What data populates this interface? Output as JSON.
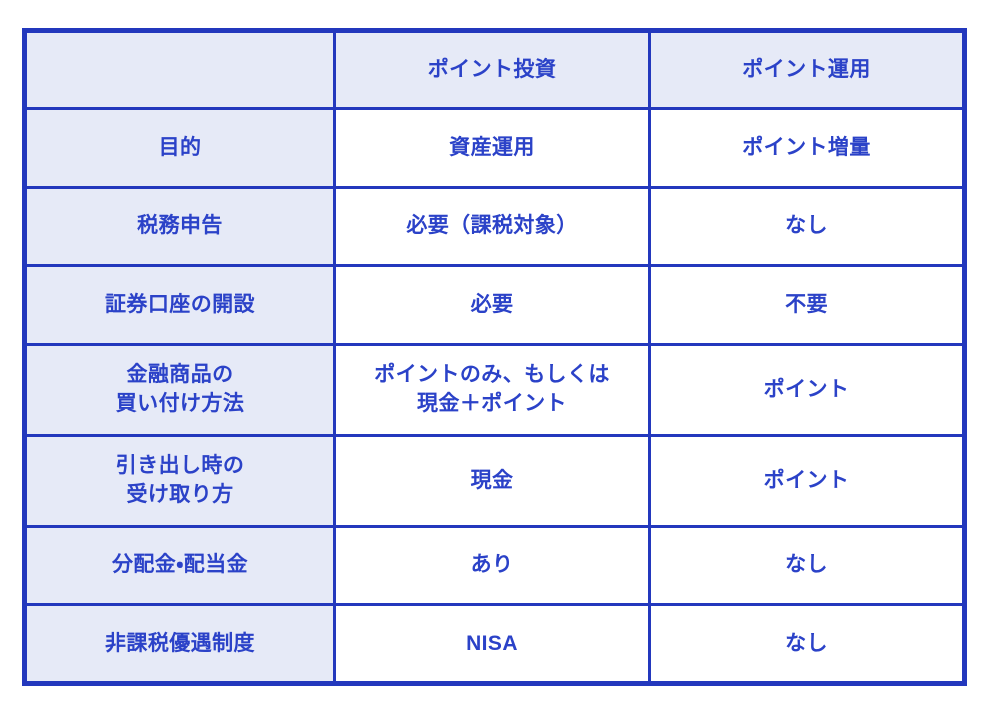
{
  "table": {
    "columns": [
      {
        "key": "label",
        "label": ""
      },
      {
        "key": "point_toushi",
        "label": "ポイント投資"
      },
      {
        "key": "point_unyou",
        "label": "ポイント運用"
      }
    ],
    "rows": [
      {
        "label": "目的",
        "label_lines": [
          "目的"
        ],
        "point_toushi": "資産運用",
        "toushi_lines": [
          "資産運用"
        ],
        "point_unyou": "ポイント増量",
        "unyou_lines": [
          "ポイント増量"
        ]
      },
      {
        "label": "税務申告",
        "label_lines": [
          "税務申告"
        ],
        "point_toushi": "必要（課税対象）",
        "toushi_lines": [
          "必要（課税対象）"
        ],
        "point_unyou": "なし",
        "unyou_lines": [
          "なし"
        ]
      },
      {
        "label": "証券口座の開設",
        "label_lines": [
          "証券口座の開設"
        ],
        "point_toushi": "必要",
        "toushi_lines": [
          "必要"
        ],
        "point_unyou": "不要",
        "unyou_lines": [
          "不要"
        ]
      },
      {
        "label": "金融商品の買い付け方法",
        "label_lines": [
          "金融商品の",
          "買い付け方法"
        ],
        "point_toushi": "ポイントのみ、もしくは現金＋ポイント",
        "toushi_lines": [
          "ポイントのみ、もしくは",
          "現金＋ポイント"
        ],
        "point_unyou": "ポイント",
        "unyou_lines": [
          "ポイント"
        ]
      },
      {
        "label": "引き出し時の受け取り方",
        "label_lines": [
          "引き出し時の",
          "受け取り方"
        ],
        "point_toushi": "現金",
        "toushi_lines": [
          "現金"
        ],
        "point_unyou": "ポイント",
        "unyou_lines": [
          "ポイント"
        ]
      },
      {
        "label": "分配金・配当金",
        "label_lines": [
          "分配金・配当金"
        ],
        "point_toushi": "あり",
        "toushi_lines": [
          "あり"
        ],
        "point_unyou": "なし",
        "unyou_lines": [
          "なし"
        ]
      },
      {
        "label": "非課税優遇制度",
        "label_lines": [
          "非課税優遇制度"
        ],
        "point_toushi": "NISA",
        "toushi_lines": [
          "NISA"
        ],
        "point_unyou": "なし",
        "unyou_lines": [
          "なし"
        ]
      }
    ]
  },
  "colors": {
    "border": "#2338bd",
    "text": "#2b42c8",
    "tinted_cell_bg": "#e6eaf7",
    "value_cell_bg": "#ffffff",
    "page_bg": "#ffffff"
  }
}
